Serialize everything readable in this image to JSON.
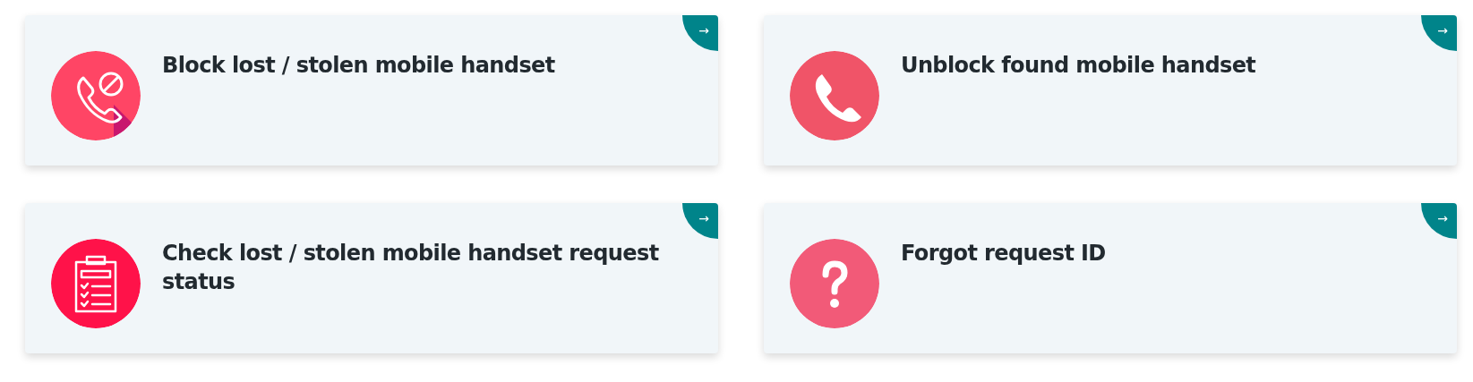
{
  "cards": [
    {
      "title": "Block lost / stolen mobile handset",
      "kind": "phone-block",
      "arrow": "→"
    },
    {
      "title": "Unblock found mobile handset",
      "kind": "phone",
      "arrow": "→"
    },
    {
      "title": "Check lost / stolen mobile handset request status",
      "kind": "clipboard",
      "arrow": "→"
    },
    {
      "title": "Forgot request ID",
      "kind": "question",
      "arrow": "→"
    }
  ]
}
